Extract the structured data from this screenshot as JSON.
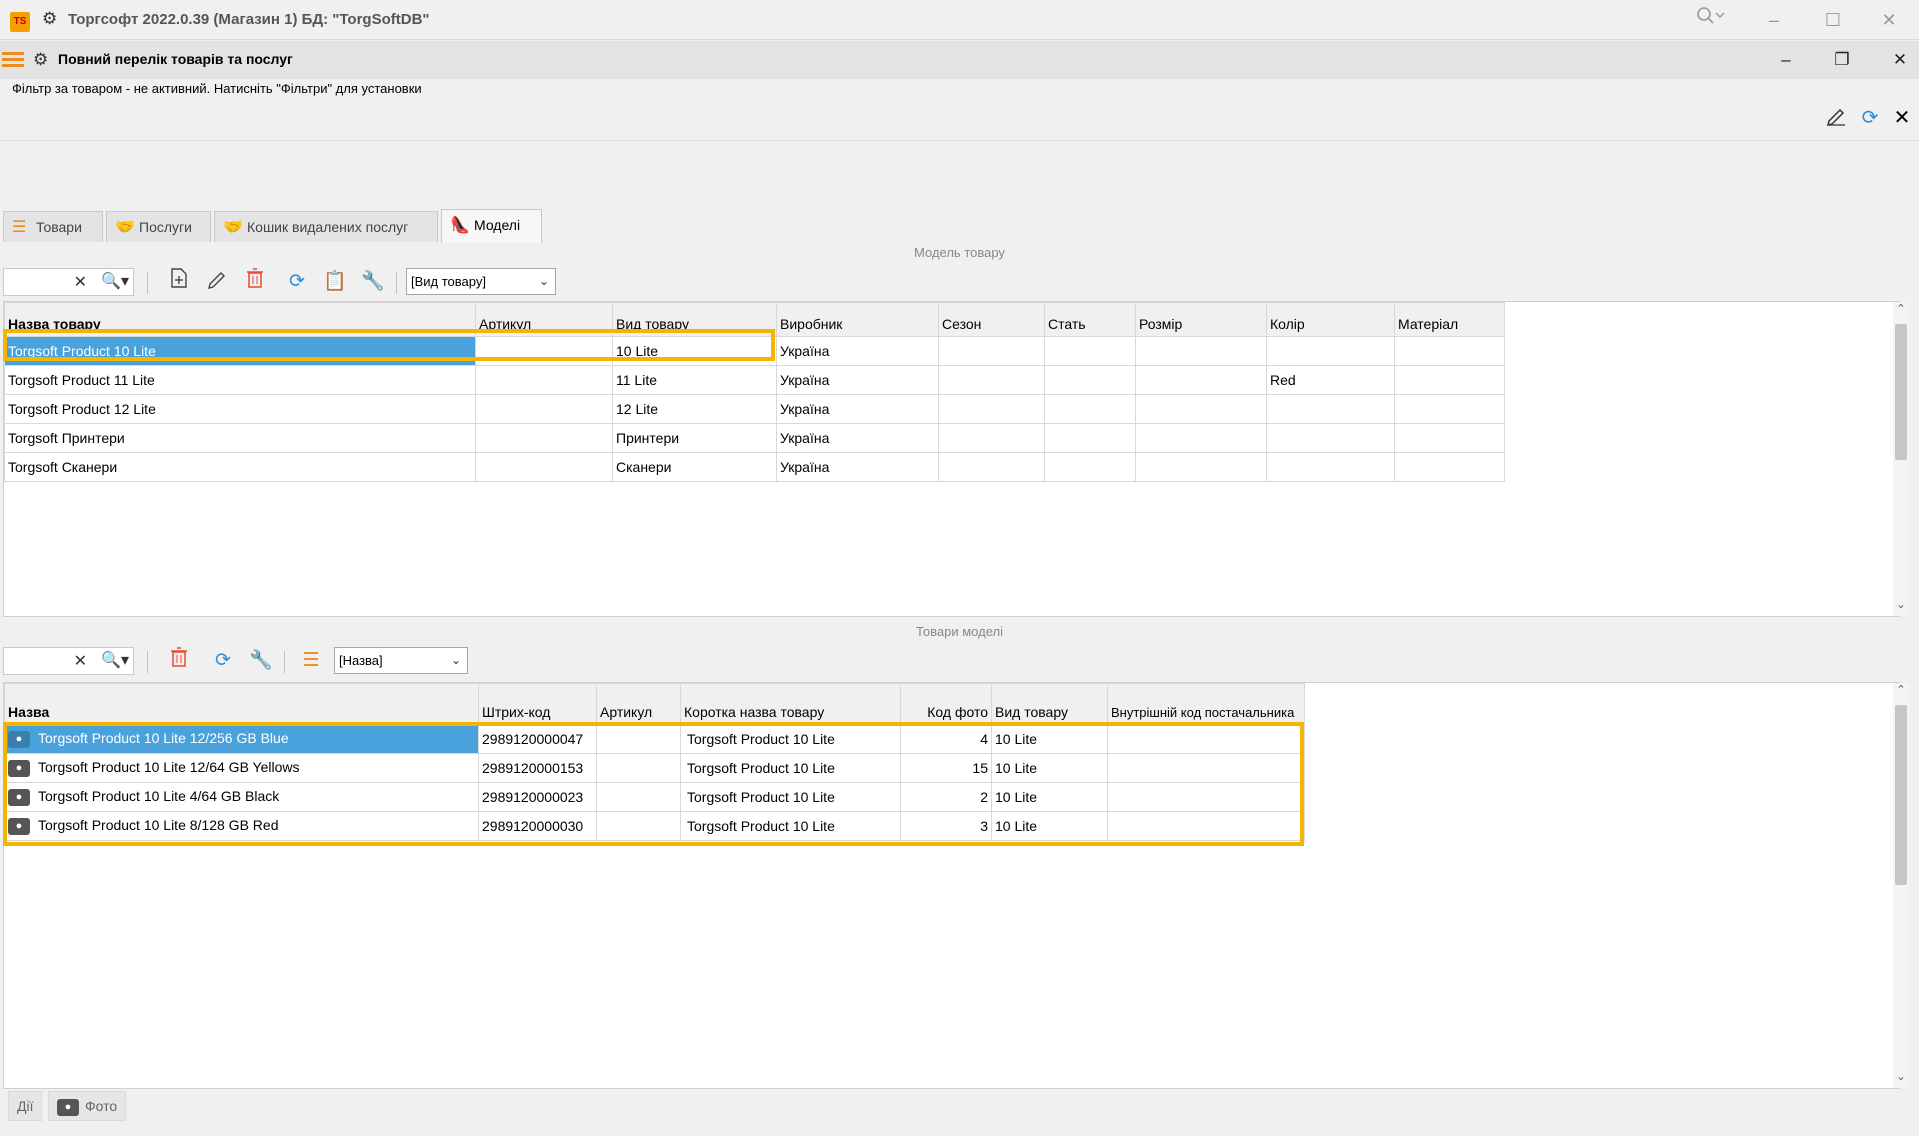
{
  "app": {
    "logo_text": "TS",
    "title": "Торгсофт 2022.0.39 (Магазин 1) БД: \"TorgSoftDB\""
  },
  "window": {
    "title": "Повний перелік товарів та послуг",
    "filter_status": "Фільтр за товаром - не активний. Натисніть \"Фільтри\" для установки"
  },
  "tabs": [
    {
      "label": "Товари",
      "icon": "list-icon"
    },
    {
      "label": "Послуги",
      "icon": "handshake-icon"
    },
    {
      "label": "Кошик видалених послуг",
      "icon": "handshake-red-icon"
    },
    {
      "label": "Моделі",
      "icon": "shoe-icon",
      "active": true
    }
  ],
  "models": {
    "caption": "Модель товару",
    "combo_value": "[Вид товару]",
    "columns": [
      "Назва товару",
      "Артикул",
      "Вид товару",
      "Виробник",
      "Сезон",
      "Стать",
      "Розмір",
      "Колір",
      "Матеріал"
    ],
    "rows": [
      [
        "Torgsoft Product 10 Lite",
        "",
        "10 Lite",
        "Україна",
        "",
        "",
        "",
        "",
        ""
      ],
      [
        "Torgsoft Product 11 Lite",
        "",
        "11 Lite",
        "Україна",
        "",
        "",
        "",
        "Red",
        ""
      ],
      [
        "Torgsoft Product 12 Lite",
        "",
        "12 Lite",
        "Україна",
        "",
        "",
        "",
        "",
        ""
      ],
      [
        "Torgsoft Принтери",
        "",
        "Принтери",
        "Україна",
        "",
        "",
        "",
        "",
        ""
      ],
      [
        "Torgsoft Сканери",
        "",
        "Сканери",
        "Україна",
        "",
        "",
        "",
        "",
        ""
      ]
    ]
  },
  "goods": {
    "caption": "Товари моделі",
    "combo_value": "[Назва]",
    "columns": [
      "Назва",
      "Штрих-код",
      "Артикул",
      "Коротка назва товару",
      "Код фото",
      "Вид товару",
      "Внутрішній код постачальника"
    ],
    "rows": [
      [
        "Torgsoft Product 10 Lite 12/256 GB Blue",
        "2989120000047",
        "",
        "Torgsoft Product 10 Lite",
        "4",
        "10 Lite",
        ""
      ],
      [
        "Torgsoft Product 10 Lite 12/64 GB Yellows",
        "2989120000153",
        "",
        "Torgsoft Product 10 Lite",
        "15",
        "10 Lite",
        ""
      ],
      [
        "Torgsoft Product 10 Lite 4/64 GB Black",
        "2989120000023",
        "",
        "Torgsoft Product 10 Lite",
        "2",
        "10 Lite",
        ""
      ],
      [
        "Torgsoft Product 10 Lite 8/128 GB Red",
        "2989120000030",
        "",
        "Torgsoft Product 10 Lite",
        "3",
        "10 Lite",
        ""
      ]
    ]
  },
  "bottom": {
    "actions_label": "Дії",
    "photo_label": "Фото"
  },
  "colors": {
    "selection": "#4aa2dc",
    "highlight": "#f5b400",
    "accent": "#f08c1a"
  }
}
